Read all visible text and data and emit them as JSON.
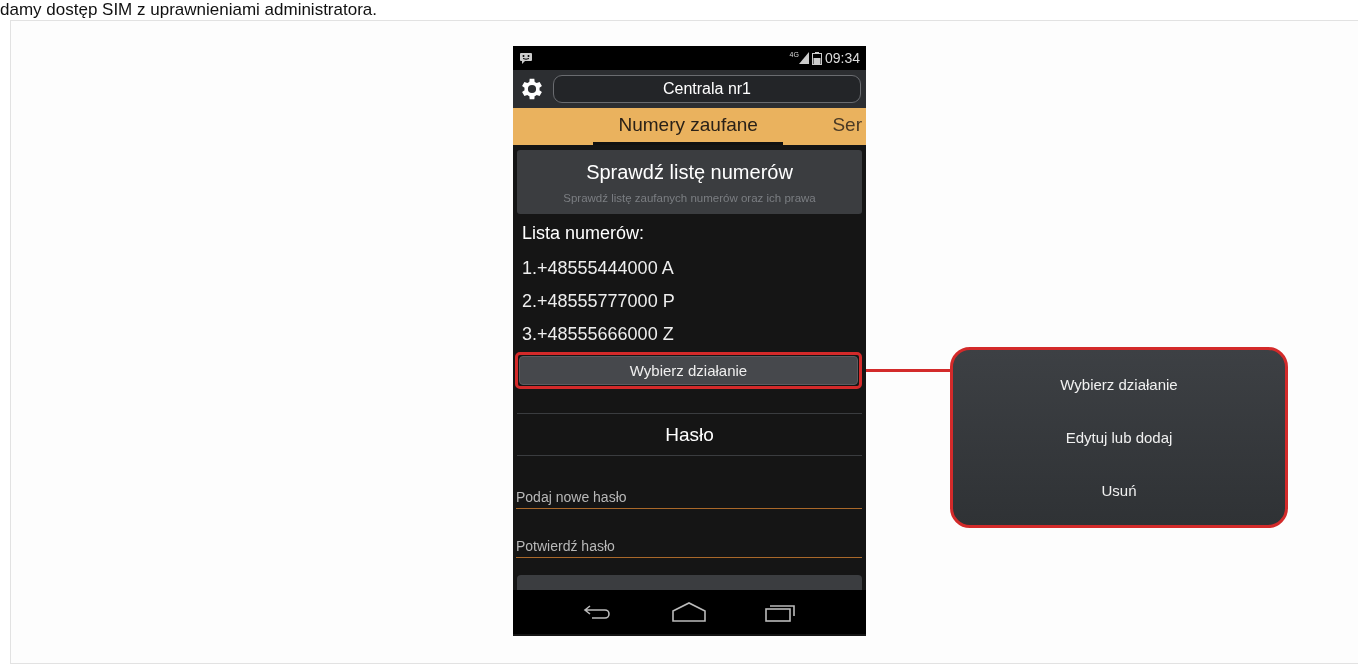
{
  "caption": "damy dostęp SIM z uprawnieniami administratora.",
  "phone": {
    "status_bar": {
      "network": "4G",
      "time": "09:34"
    },
    "header": {
      "title": "Centrala nr1"
    },
    "tabs": [
      {
        "label": "Numery zaufane",
        "selected": true
      },
      {
        "label": "Ser",
        "selected": false
      }
    ],
    "check_button": {
      "label": "Sprawdź listę numerów",
      "description": "Sprawdź listę zaufanych numerów oraz ich prawa"
    },
    "list_heading": "Lista numerów:",
    "numbers": [
      "1.+48555444000 A",
      "2.+48555777000 P",
      "3.+48555666000 Z"
    ],
    "action_dropdown": {
      "label": "Wybierz działanie",
      "highlighted": true
    },
    "password_section": {
      "title": "Hasło",
      "fields": [
        {
          "placeholder": "Podaj nowe hasło"
        },
        {
          "placeholder": "Potwierdź hasło"
        }
      ]
    }
  },
  "callout_menu": {
    "items": [
      "Wybierz działanie",
      "Edytuj lub dodaj",
      "Usuń"
    ]
  }
}
